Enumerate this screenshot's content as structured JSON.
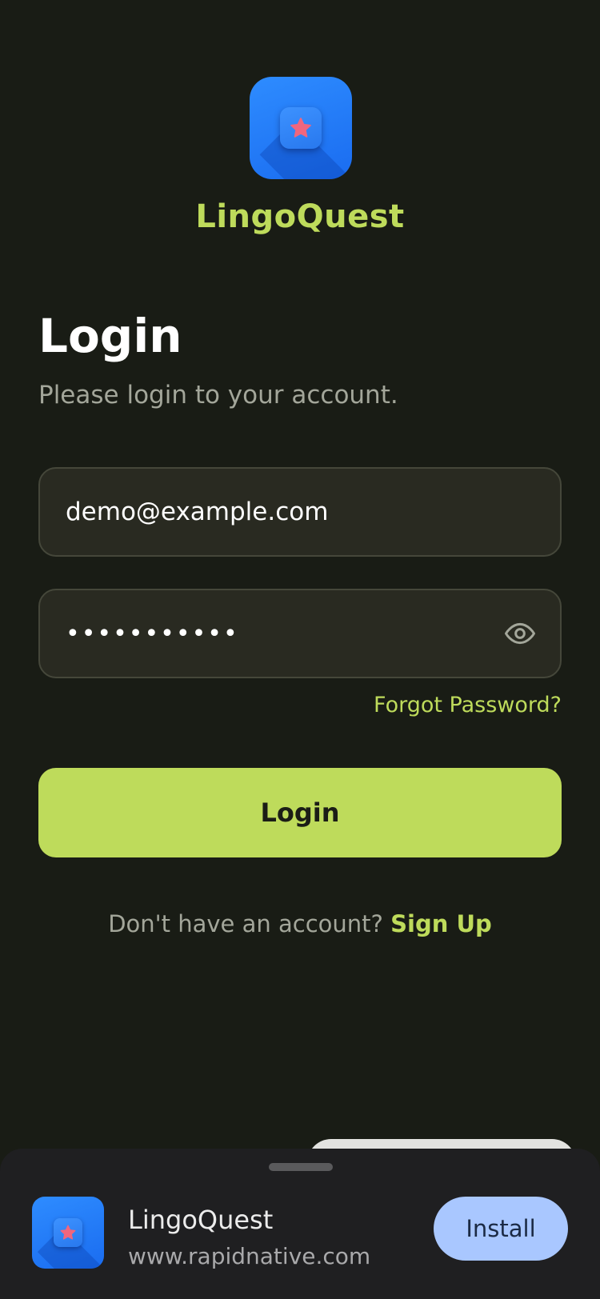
{
  "brand": {
    "name": "LingoQuest",
    "icon": "star-app-icon"
  },
  "login": {
    "title": "Login",
    "subtitle": "Please login to your account.",
    "email_value": "demo@example.com",
    "password_masked": "•••••••••••",
    "password_toggle_icon": "eye-icon",
    "forgot_label": "Forgot Password?",
    "button_label": "Login",
    "signup_prompt": "Don't have an account?",
    "signup_label": "Sign Up"
  },
  "install_banner": {
    "app_name": "LingoQuest",
    "url": "www.rapidnative.com",
    "install_label": "Install"
  },
  "colors": {
    "background": "#191c15",
    "accent": "#bedb5b",
    "field_bg": "#292a21",
    "icon_blue": "#2e8cff",
    "star": "#f0667e",
    "install_bg": "#a9c7ff"
  }
}
